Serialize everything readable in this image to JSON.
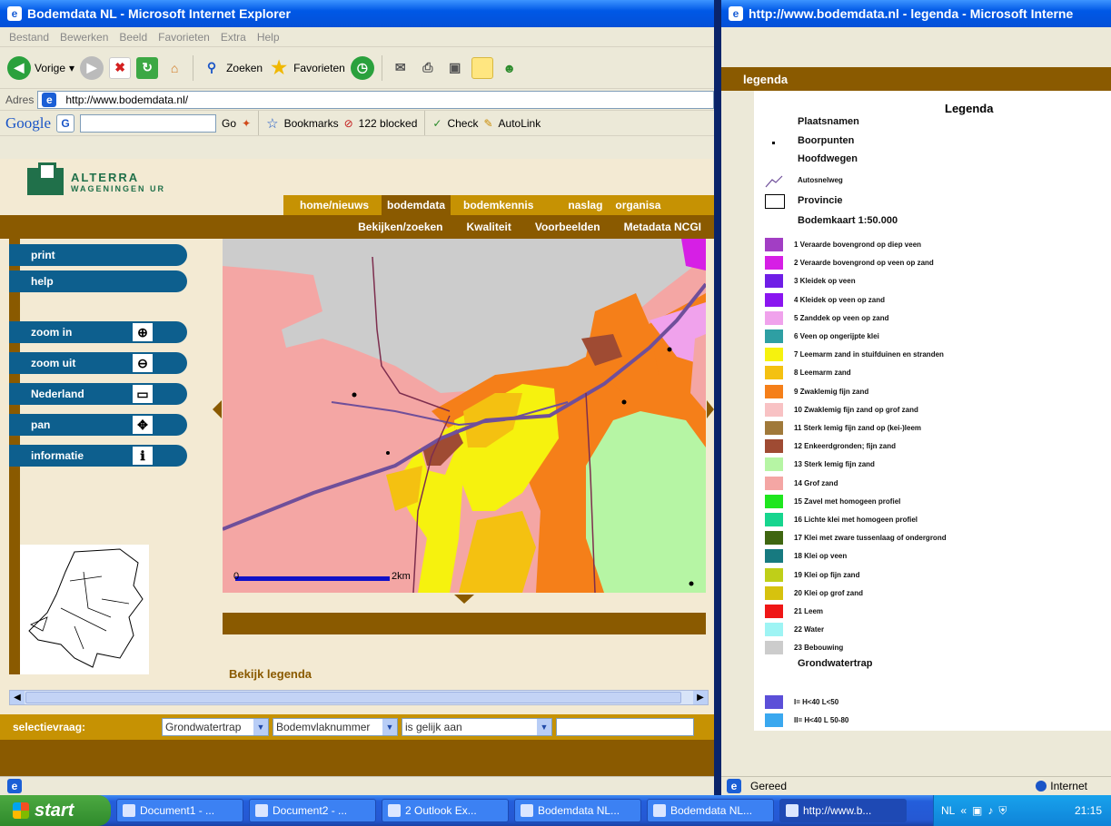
{
  "main_window": {
    "title": "Bodemdata NL - Microsoft Internet Explorer",
    "menu": [
      "Bestand",
      "Bewerken",
      "Beeld",
      "Favorieten",
      "Extra",
      "Help"
    ],
    "toolbar": {
      "back": "Vorige",
      "search": "Zoeken",
      "favorites": "Favorieten"
    },
    "address_label": "Adres",
    "address_value": "http://www.bodemdata.nl/",
    "google": {
      "logo": "Google",
      "go": "Go",
      "bookmarks": "Bookmarks",
      "blocked": "122 blocked",
      "check": "Check",
      "autolink": "AutoLink"
    },
    "status": "Gereed"
  },
  "site": {
    "logo_line1": "ALTERRA",
    "logo_line2": "WAGENINGEN UR",
    "topnav": [
      "home/nieuws",
      "bodemdata",
      "bodemkennis",
      "naslag",
      "organisa"
    ],
    "subnav": [
      "Bekijken/zoeken",
      "Kwaliteit",
      "Voorbeelden",
      "Metadata NCGI"
    ],
    "side_buttons": [
      {
        "label": "print",
        "icon": "print-icon"
      },
      {
        "label": "help",
        "icon": "help-icon"
      },
      {
        "label": "zoom in",
        "icon": "zoom-in-icon",
        "glyph": "⊕"
      },
      {
        "label": "zoom uit",
        "icon": "zoom-out-icon",
        "glyph": "⊖"
      },
      {
        "label": "Nederland",
        "icon": "full-extent-icon",
        "glyph": "▭"
      },
      {
        "label": "pan",
        "icon": "pan-icon",
        "glyph": "✥"
      },
      {
        "label": "informatie",
        "icon": "info-icon",
        "glyph": "ℹ"
      }
    ],
    "scale": {
      "start": "0",
      "end": "2km"
    },
    "legend_link": "Bekijk legenda",
    "selection": {
      "label": "selectievraag:",
      "field1": "Grondwatertrap",
      "field2": "Bodemvlaknummer",
      "operator": "is gelijk aan",
      "value": ""
    }
  },
  "legend_window": {
    "title": "http://www.bodemdata.nl - legenda - Microsoft Interne",
    "header": "legenda",
    "title_text": "Legenda",
    "top_items": [
      "Plaatsnamen",
      "Boorpunten",
      "Hoofdwegen",
      "Autosnelweg",
      "Provincie"
    ],
    "section": "Bodemkaart 1:50.000",
    "soil_items": [
      {
        "label": "1 Veraarde bovengrond op diep veen",
        "color": "#a23ec4"
      },
      {
        "label": "2 Veraarde bovengrond op veen op zand",
        "color": "#d61fe5"
      },
      {
        "label": "3 Kleidek op veen",
        "color": "#6f1ee6"
      },
      {
        "label": "4 Kleidek op veen op zand",
        "color": "#8a15f0"
      },
      {
        "label": "5 Zanddek op veen op zand",
        "color": "#f0a2ec"
      },
      {
        "label": "6 Veen op ongerijpte klei",
        "color": "#2e9fa3"
      },
      {
        "label": "7 Leemarm zand in stuifduinen en stranden",
        "color": "#f6f20e"
      },
      {
        "label": "8 Leemarm zand",
        "color": "#f4c111"
      },
      {
        "label": "9 Zwaklemig fijn zand",
        "color": "#f57f19"
      },
      {
        "label": "10 Zwaklemig fijn zand op grof zand",
        "color": "#f8c2c4"
      },
      {
        "label": "11 Sterk lemig fijn zand op (kei-)leem",
        "color": "#a0793a"
      },
      {
        "label": "12 Enkeerdgronden; fijn zand",
        "color": "#9f4b33"
      },
      {
        "label": "13 Sterk lemig fijn zand",
        "color": "#b6f5a4"
      },
      {
        "label": "14 Grof zand",
        "color": "#f4a6a4"
      },
      {
        "label": "15 Zavel met homogeen profiel",
        "color": "#1ee61e"
      },
      {
        "label": "16 Lichte klei met homogeen profiel",
        "color": "#16d58e"
      },
      {
        "label": "17 Klei met zware tussenlaag of ondergrond",
        "color": "#3f6610"
      },
      {
        "label": "18 Klei op veen",
        "color": "#177a80"
      },
      {
        "label": "19 Klei op fijn zand",
        "color": "#bfcf18"
      },
      {
        "label": "20 Klei op grof zand",
        "color": "#d6c20e"
      },
      {
        "label": "21 Leem",
        "color": "#ef1616"
      },
      {
        "label": "22 Water",
        "color": "#9ef4f4"
      },
      {
        "label": "23 Bebouwing",
        "color": "#cccccc"
      }
    ],
    "section2": "Grondwatertrap",
    "gwt_items": [
      {
        "label": "I= H<40 L<50",
        "color": "#5b4fd8"
      },
      {
        "label": "II= H<40 L 50-80",
        "color": "#3aa8ef"
      }
    ],
    "status": "Gereed",
    "zone": "Internet"
  },
  "taskbar": {
    "start": "start",
    "tasks": [
      "Document1 - ...",
      "Document2 - ...",
      "2 Outlook Ex...",
      "Bodemdata NL...",
      "Bodemdata NL...",
      "http://www.b..."
    ],
    "lang": "NL",
    "clock": "21:15"
  }
}
